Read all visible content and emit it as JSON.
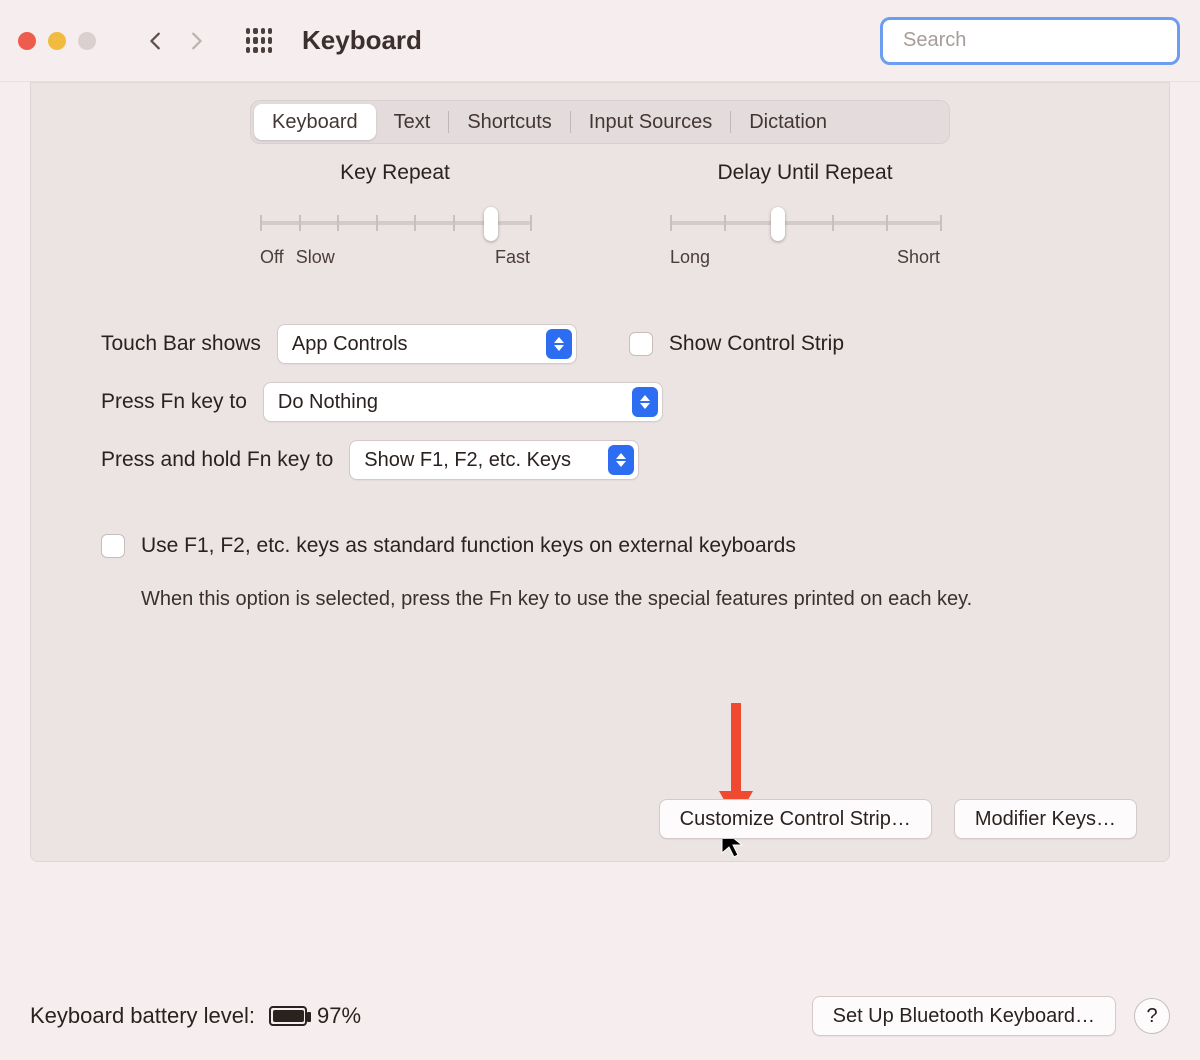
{
  "window": {
    "title": "Keyboard",
    "search_placeholder": "Search"
  },
  "tabs": [
    "Keyboard",
    "Text",
    "Shortcuts",
    "Input Sources",
    "Dictation"
  ],
  "active_tab_index": 0,
  "sliders": {
    "key_repeat": {
      "title": "Key Repeat",
      "left_labels": [
        "Off",
        "Slow"
      ],
      "right_label": "Fast",
      "ticks": 8,
      "value_index": 6
    },
    "delay_until": {
      "title": "Delay Until Repeat",
      "left_labels": [
        "Long"
      ],
      "right_label": "Short",
      "ticks": 6,
      "value_index": 2
    }
  },
  "controls": {
    "touchbar": {
      "label": "Touch Bar shows",
      "value": "App Controls"
    },
    "control_strip": {
      "label": "Show Control Strip",
      "checked": false
    },
    "press_fn": {
      "label": "Press Fn key to",
      "value": "Do Nothing"
    },
    "hold_fn": {
      "label": "Press and hold Fn key to",
      "value": "Show F1, F2, etc. Keys"
    }
  },
  "function_keys": {
    "checkbox_label": "Use F1, F2, etc. keys as standard function keys on external keyboards",
    "description": "When this option is selected, press the Fn key to use the special features printed on each key.",
    "checked": false
  },
  "buttons": {
    "customize": "Customize Control Strip…",
    "modifier": "Modifier Keys…",
    "bluetooth": "Set Up Bluetooth Keyboard…"
  },
  "footer": {
    "battery_label": "Keyboard battery level:",
    "battery_level": "97%"
  }
}
